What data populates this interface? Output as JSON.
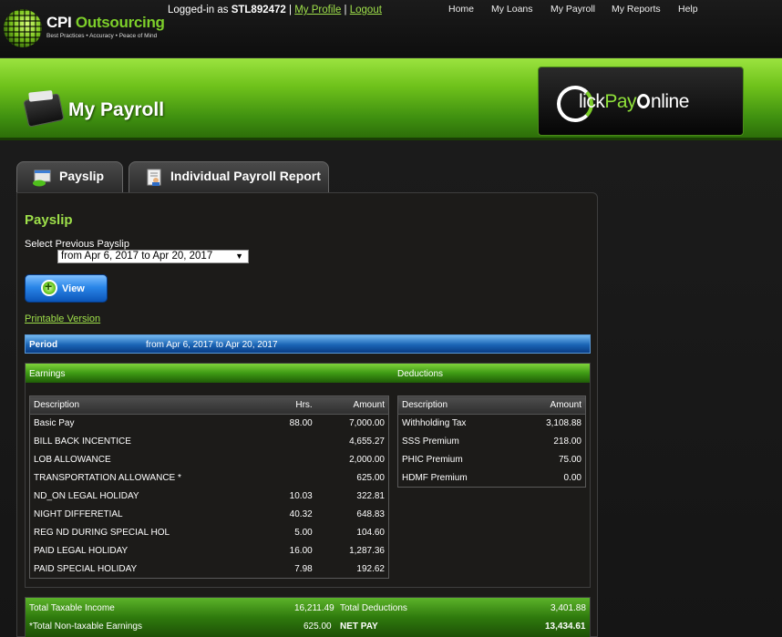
{
  "brand": {
    "name_first": "CPI",
    "name_second": "Outsourcing",
    "tagline": "Best Practices • Accuracy • Peace of Mind"
  },
  "session": {
    "prefix": "Logged-in as",
    "user_id": "STL892472",
    "separator": "|",
    "profile_link": "My Profile",
    "logout_link": "Logout"
  },
  "nav": {
    "items": [
      "Home",
      "My Loans",
      "My Payroll",
      "My Reports",
      "Help"
    ]
  },
  "banner": {
    "title": "My Payroll",
    "product_logo_part1": "lick",
    "product_logo_part2": "Pay",
    "product_logo_part3": "nline"
  },
  "tabs": [
    {
      "label": "Payslip"
    },
    {
      "label": "Individual Payroll Report"
    }
  ],
  "payslip": {
    "title": "Payslip",
    "select_label": "Select Previous Payslip",
    "selected_period": "from Apr 6, 2017 to Apr 20, 2017",
    "view_button": "View",
    "printable_link": "Printable Version",
    "period_label": "Period",
    "period_value": "from Apr 6, 2017 to Apr 20, 2017"
  },
  "earnings": {
    "section_label": "Earnings",
    "headers": {
      "description": "Description",
      "hours": "Hrs.",
      "amount": "Amount"
    },
    "rows": [
      {
        "description": "Basic Pay",
        "hours": "88.00",
        "amount": "7,000.00"
      },
      {
        "description": "BILL BACK INCENTICE",
        "hours": "",
        "amount": "4,655.27"
      },
      {
        "description": "LOB ALLOWANCE",
        "hours": "",
        "amount": "2,000.00"
      },
      {
        "description": "TRANSPORTATION ALLOWANCE *",
        "hours": "",
        "amount": "625.00"
      },
      {
        "description": "ND_ON LEGAL HOLIDAY",
        "hours": "10.03",
        "amount": "322.81"
      },
      {
        "description": "NIGHT DIFFERETIAL",
        "hours": "40.32",
        "amount": "648.83"
      },
      {
        "description": "REG ND DURING SPECIAL HOL",
        "hours": "5.00",
        "amount": "104.60"
      },
      {
        "description": "PAID LEGAL HOLIDAY",
        "hours": "16.00",
        "amount": "1,287.36"
      },
      {
        "description": "PAID SPECIAL HOLIDAY",
        "hours": "7.98",
        "amount": "192.62"
      }
    ]
  },
  "deductions": {
    "section_label": "Deductions",
    "headers": {
      "description": "Description",
      "amount": "Amount"
    },
    "rows": [
      {
        "description": "Withholding Tax",
        "amount": "3,108.88"
      },
      {
        "description": "SSS Premium",
        "amount": "218.00"
      },
      {
        "description": "PHIC Premium",
        "amount": "75.00"
      },
      {
        "description": "HDMF Premium",
        "amount": "0.00"
      }
    ]
  },
  "totals": {
    "taxable_label": "Total Taxable Income",
    "taxable_value": "16,211.49",
    "nontaxable_label": "*Total Non-taxable Earnings",
    "nontaxable_value": "625.00",
    "deductions_label": "Total Deductions",
    "deductions_value": "3,401.88",
    "netpay_label": "NET PAY",
    "netpay_value": "13,434.61"
  },
  "colors": {
    "accent_green": "#9ee04a",
    "banner_green": "#6fc21b",
    "period_blue": "#1a64b5"
  }
}
